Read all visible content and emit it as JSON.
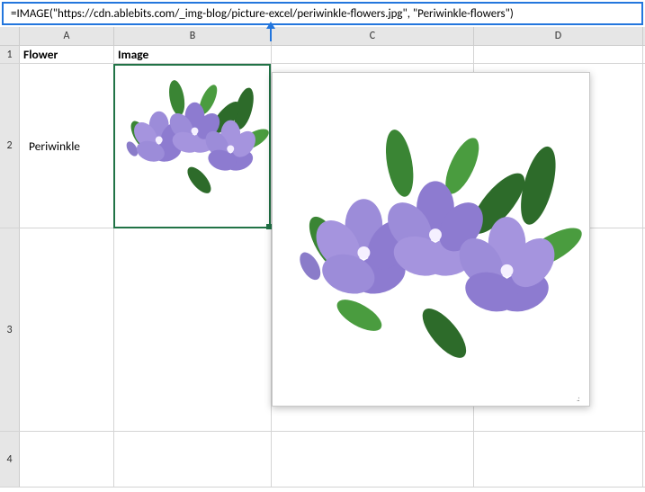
{
  "formula": "=IMAGE(\"https://cdn.ablebits.com/_img-blog/picture-excel/periwinkle-flowers.jpg\", \"Periwinkle-flowers\")",
  "columns": {
    "A": "A",
    "B": "B",
    "C": "C",
    "D": "D"
  },
  "rows": {
    "r1": "1",
    "r2": "2",
    "r3": "3",
    "r4": "4"
  },
  "cells": {
    "A1": "Flower",
    "B1": "Image",
    "A2": "Periwinkle"
  },
  "popup_resize": ".:"
}
